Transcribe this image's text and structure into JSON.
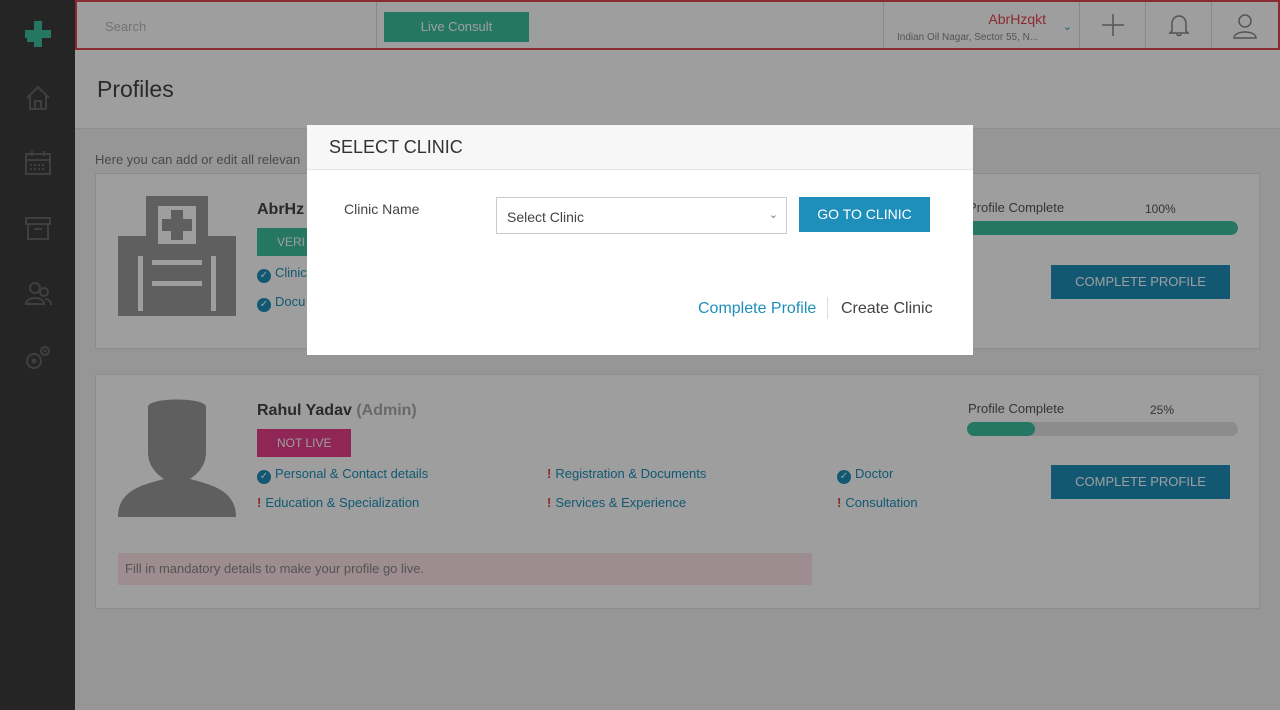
{
  "topbar": {
    "search_placeholder": "Search",
    "live_consult": "Live Consult",
    "clinic_name": "AbrHzqkt",
    "clinic_address": "Indian Oil Nagar, Sector 55, N..."
  },
  "page": {
    "title": "Profiles",
    "hint": "Here you can add or edit all relevan"
  },
  "profiles": [
    {
      "name": "AbrHz",
      "badge": "VERI",
      "items": [
        "Clinic",
        "Docu"
      ],
      "complete_label": "Profile Complete",
      "complete_value": "100%",
      "progress": 1.0,
      "button": "COMPLETE PROFILE"
    },
    {
      "name": "Rahul Yadav",
      "role": "(Admin)",
      "badge": "NOT LIVE",
      "items": [
        {
          "label": "Personal & Contact details",
          "status": "done"
        },
        {
          "label": "Registration & Documents",
          "status": "pending"
        },
        {
          "label": "Doctor",
          "status": "done"
        },
        {
          "label": "Education & Specialization",
          "status": "pending"
        },
        {
          "label": "Services & Experience",
          "status": "pending"
        },
        {
          "label": "Consultation",
          "status": "pending"
        }
      ],
      "complete_label": "Profile Complete",
      "complete_value": "25%",
      "progress": 0.25,
      "button": "COMPLETE PROFILE",
      "warning": "Fill in mandatory details to make your profile go live."
    }
  ],
  "modal": {
    "title": "SELECT CLINIC",
    "field_label": "Clinic Name",
    "select_value": "Select Clinic",
    "go_button": "GO TO CLINIC",
    "complete_profile_link": "Complete Profile",
    "create_clinic_link": "Create Clinic"
  },
  "colors": {
    "accent_blue": "#1e8fba",
    "accent_green": "#3cc0a0",
    "accent_red": "#e0454f",
    "accent_pink": "#e83e8c"
  }
}
